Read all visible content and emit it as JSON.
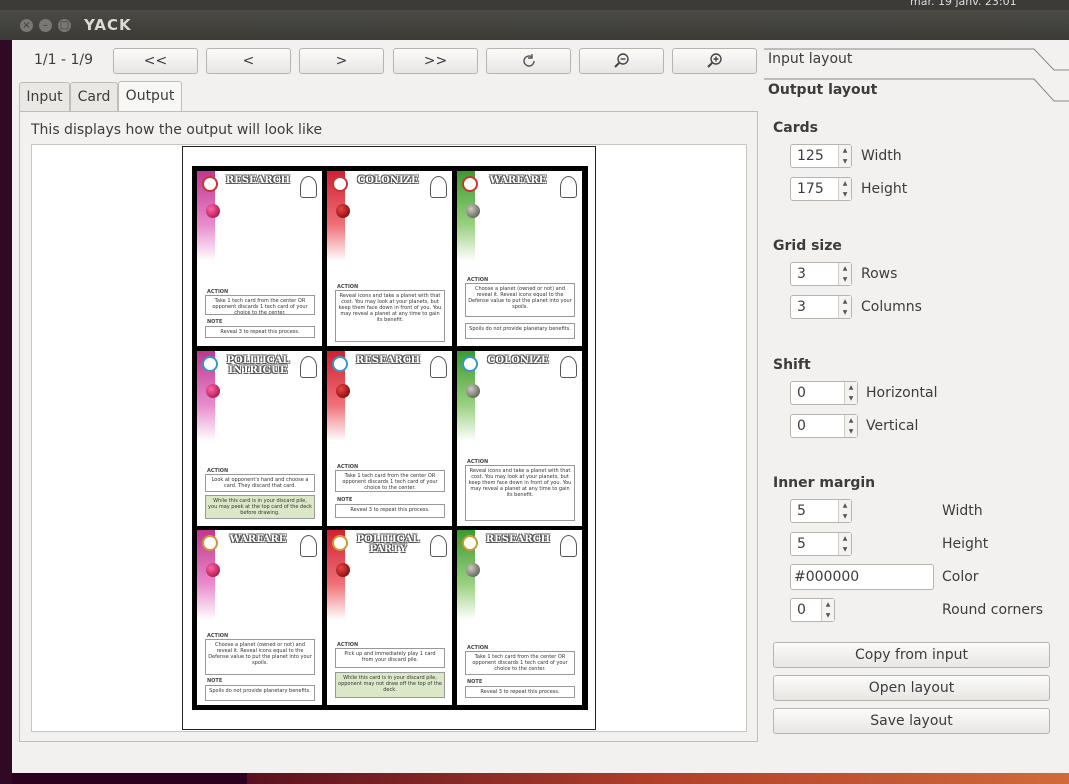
{
  "window": {
    "title": "YACK"
  },
  "topbar": {
    "clock": "mar. 19 janv. 23:01"
  },
  "toolbar": {
    "page_info": "1/1 - 1/9",
    "first": "<<",
    "prev": "<",
    "next": ">",
    "last": ">>",
    "refresh_icon": "refresh-icon",
    "zoom_out_icon": "zoom-out-icon",
    "zoom_in_icon": "zoom-in-icon"
  },
  "tabs": [
    {
      "label": "Input"
    },
    {
      "label": "Card"
    },
    {
      "label": "Output"
    }
  ],
  "output": {
    "description": "This displays how the output will look like"
  },
  "preview_cards": [
    {
      "title": "RESEARCH"
    },
    {
      "title": "COLONIZE"
    },
    {
      "title": "WARFARE"
    },
    {
      "title": "POLITICAL INTRIGUE"
    },
    {
      "title": "RESEARCH"
    },
    {
      "title": "COLONIZE"
    },
    {
      "title": "WARFARE"
    },
    {
      "title": "POLITICAL PARTY"
    },
    {
      "title": "RESEARCH"
    }
  ],
  "right_panel": {
    "input_layout": "Input layout",
    "output_layout": "Output layout",
    "cards": {
      "heading": "Cards",
      "width_value": "125",
      "width_label": "Width",
      "height_value": "175",
      "height_label": "Height"
    },
    "grid": {
      "heading": "Grid size",
      "rows_value": "3",
      "rows_label": "Rows",
      "cols_value": "3",
      "cols_label": "Columns"
    },
    "shift": {
      "heading": "Shift",
      "h_value": "0",
      "h_label": "Horizontal",
      "v_value": "0",
      "v_label": "Vertical"
    },
    "inner_margin": {
      "heading": "Inner margin",
      "w_value": "5",
      "w_label": "Width",
      "h_value": "5",
      "h_label": "Height",
      "color_value": "#000000",
      "color_label": "Color",
      "round_value": "0",
      "round_label": "Round corners"
    },
    "buttons": {
      "copy": "Copy from input",
      "open": "Open layout",
      "save": "Save layout"
    }
  }
}
